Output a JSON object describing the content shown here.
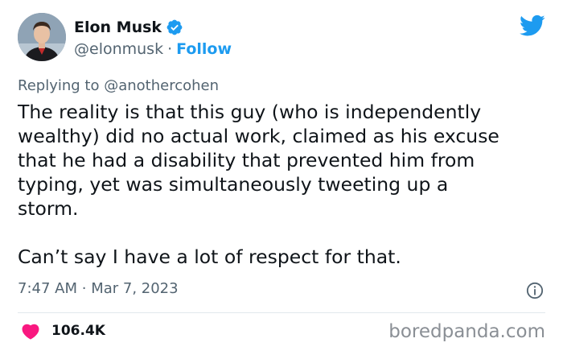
{
  "author": {
    "display_name": "Elon Musk",
    "handle": "@elonmusk",
    "separator": "·",
    "follow_label": "Follow",
    "avatar_icon": "avatar-portrait"
  },
  "reply": {
    "prefix": "Replying to",
    "to_handle": "@anothercohen"
  },
  "tweet": {
    "paragraph_1": "The reality is that this guy (who is independently\nwealthy) did no actual work, claimed as his excuse\nthat he had a disability that prevented him from\ntyping, yet was simultaneously tweeting up a\nstorm.",
    "paragraph_2": "Can’t say I have a lot of respect for that.",
    "time": "7:47 AM",
    "date_separator": "·",
    "date": "Mar 7, 2023"
  },
  "engagement": {
    "likes": "106.4K"
  },
  "watermark": "boredpanda.com",
  "colors": {
    "accent": "#1d9bf0",
    "heart": "#f91880",
    "secondary_text": "#536471"
  },
  "icons": {
    "verified": "verified-badge-icon",
    "logo": "twitter-bird-icon",
    "info": "info-icon",
    "like": "heart-icon"
  }
}
